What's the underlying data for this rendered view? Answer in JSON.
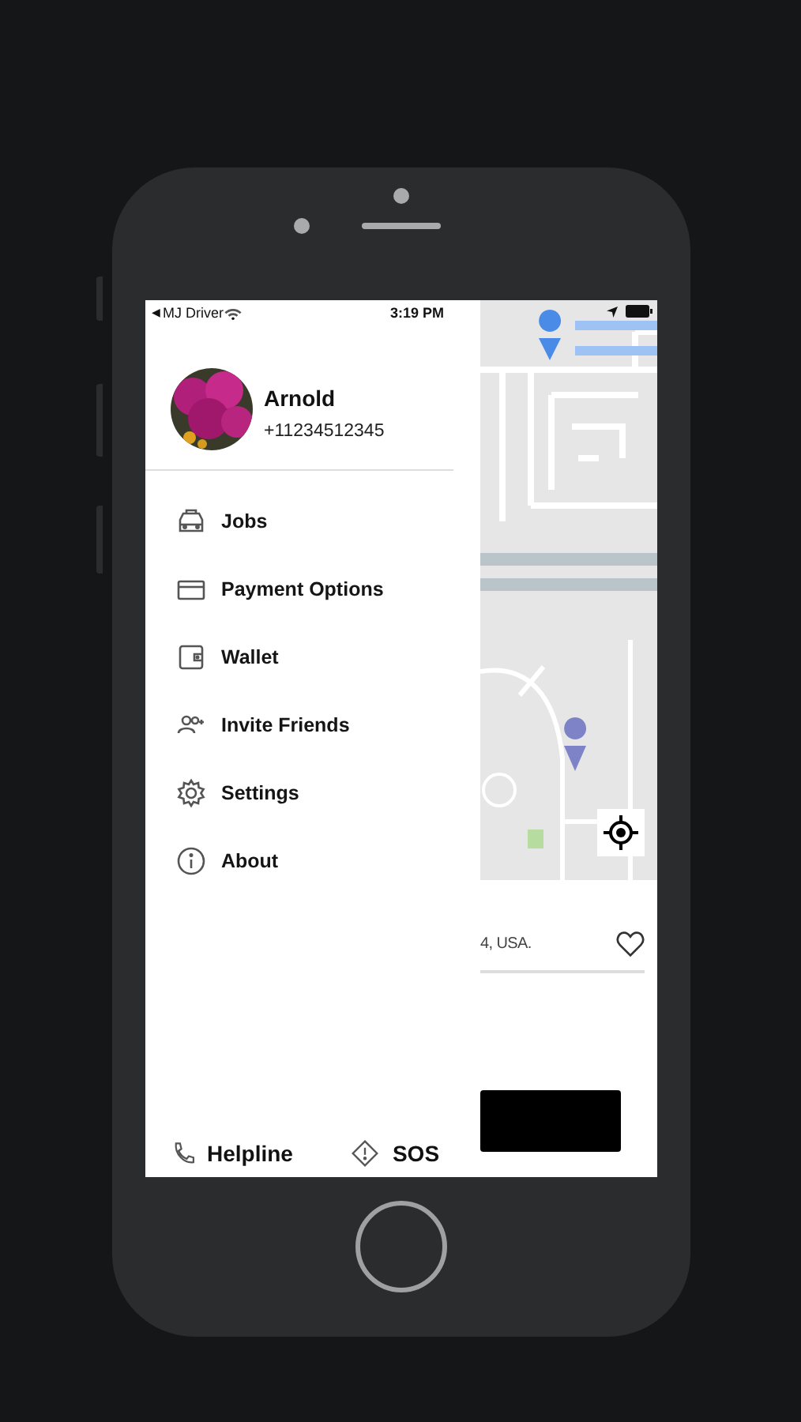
{
  "status_bar": {
    "back_label": "◀",
    "carrier": "MJ Driver",
    "time": "3:19 PM"
  },
  "profile": {
    "name": "Arnold",
    "phone": "+11234512345"
  },
  "menu": [
    {
      "label": "Jobs"
    },
    {
      "label": "Payment Options"
    },
    {
      "label": "Wallet"
    },
    {
      "label": "Invite Friends"
    },
    {
      "label": "Settings"
    },
    {
      "label": "About"
    }
  ],
  "footer": [
    {
      "label": "Helpline"
    },
    {
      "label": "SOS"
    }
  ],
  "destination": {
    "address": "4, USA.",
    "favorite": false
  }
}
